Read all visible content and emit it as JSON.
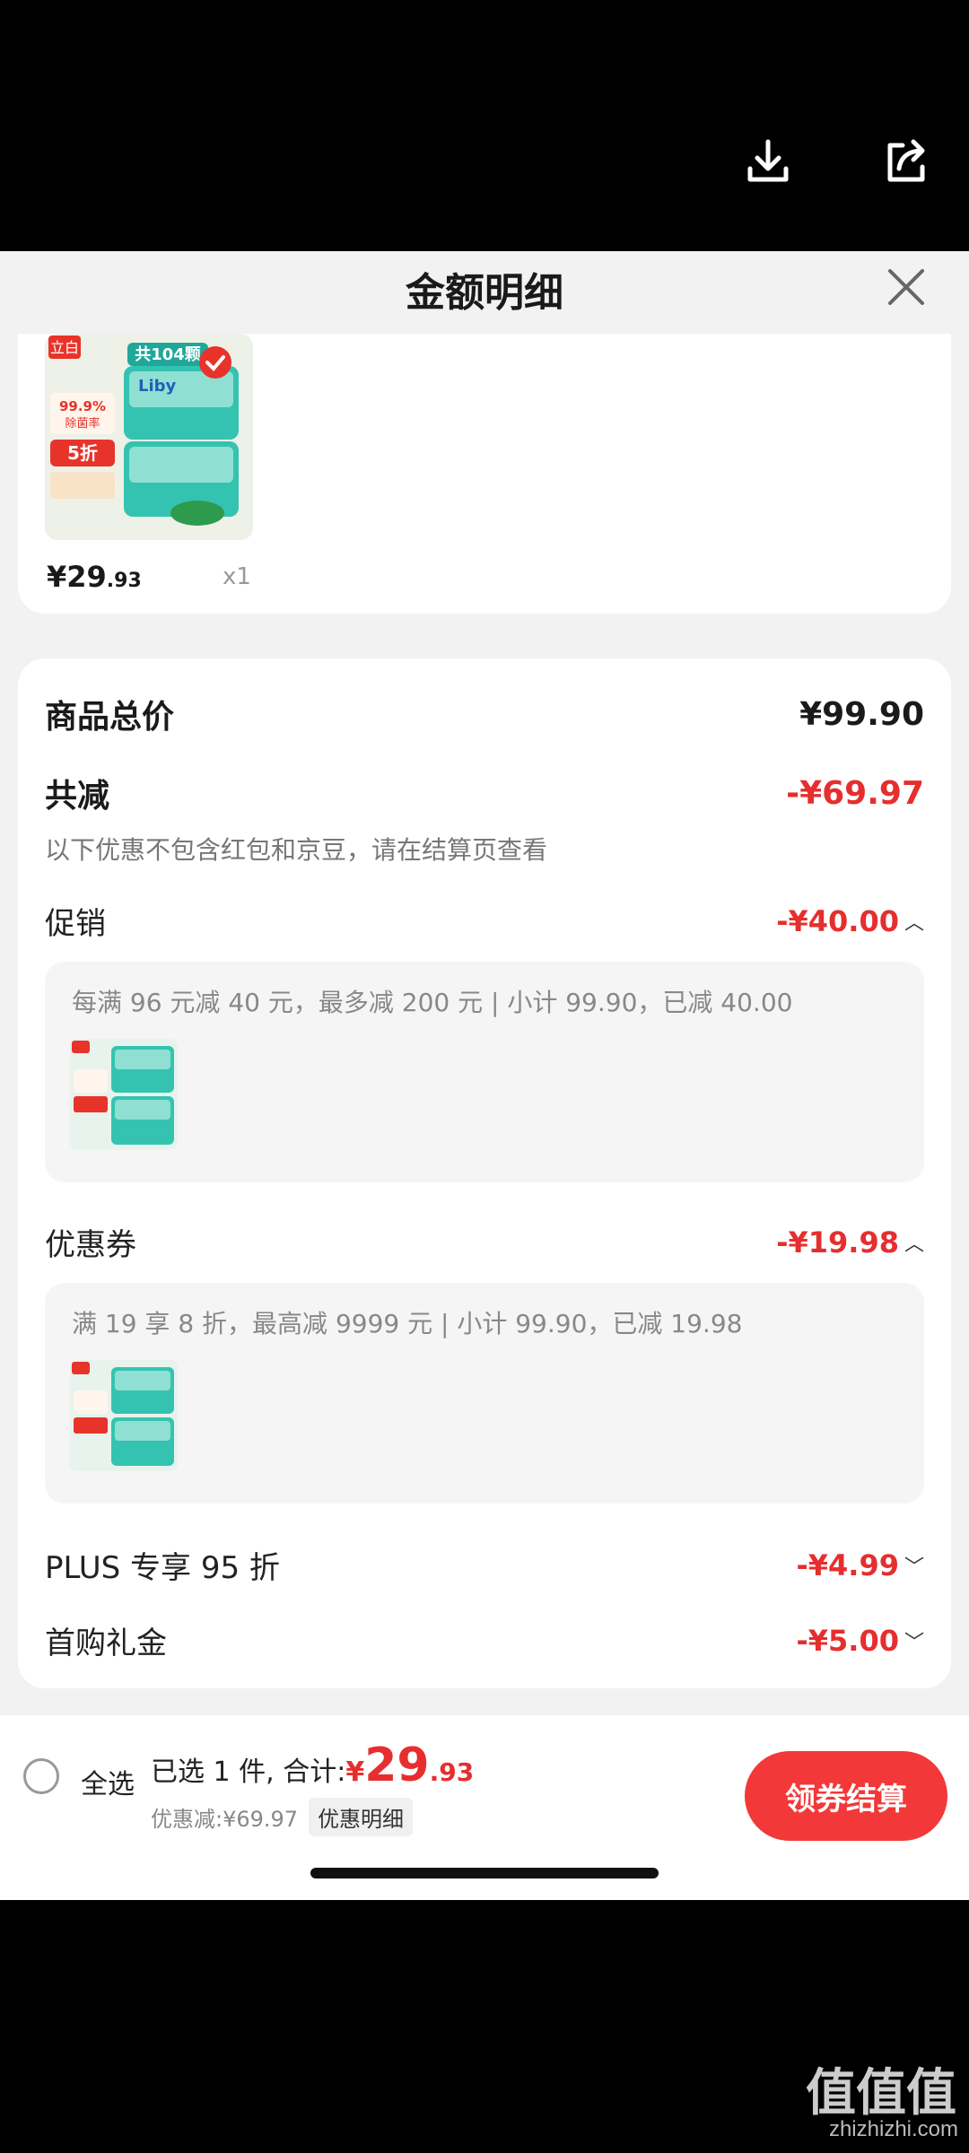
{
  "top_bar": {
    "download_icon": "download-icon",
    "share_icon": "share-icon"
  },
  "sheet": {
    "title": "金额明细"
  },
  "product": {
    "price_main": "¥29",
    "price_dec": ".93",
    "quantity": "x1",
    "image_texts": {
      "brand_corner": "立白",
      "banner": "共104颗",
      "logo": "Liby",
      "stat": "99.9%",
      "stat_label": "除菌率",
      "promo": "5折"
    }
  },
  "summary": {
    "total_label": "商品总价",
    "total_value": "¥99.90",
    "discount_label": "共减",
    "discount_value": "-¥69.97",
    "note": "以下优惠不包含红包和京豆，请在结算页查看"
  },
  "promotion": {
    "label": "促销",
    "value": "-¥40.00",
    "desc": "每满 96 元减 40 元，最多减 200 元 | 小计 99.90，已减 40.00"
  },
  "coupon": {
    "label": "优惠券",
    "value": "-¥19.98",
    "desc": "满 19 享 8 折，最高减 9999 元 | 小计 99.90，已减 19.98"
  },
  "plus": {
    "label": "PLUS 专享 95 折",
    "value": "-¥4.99"
  },
  "first_purchase": {
    "label": "首购礼金",
    "value": "-¥5.00"
  },
  "footer": {
    "select_all": "全选",
    "selected_text": "已选 1 件, 合计:",
    "total_yen": "¥",
    "total_int": "29",
    "total_dec": ".93",
    "discount_text": "优惠减:¥69.97",
    "detail_tag": "优惠明细",
    "checkout_label": "领券结算"
  },
  "watermark": {
    "text": "zhizhizhi.com",
    "logo": "值值值"
  },
  "colors": {
    "accent_red": "#e62e2e",
    "button_red": "#f23838"
  }
}
